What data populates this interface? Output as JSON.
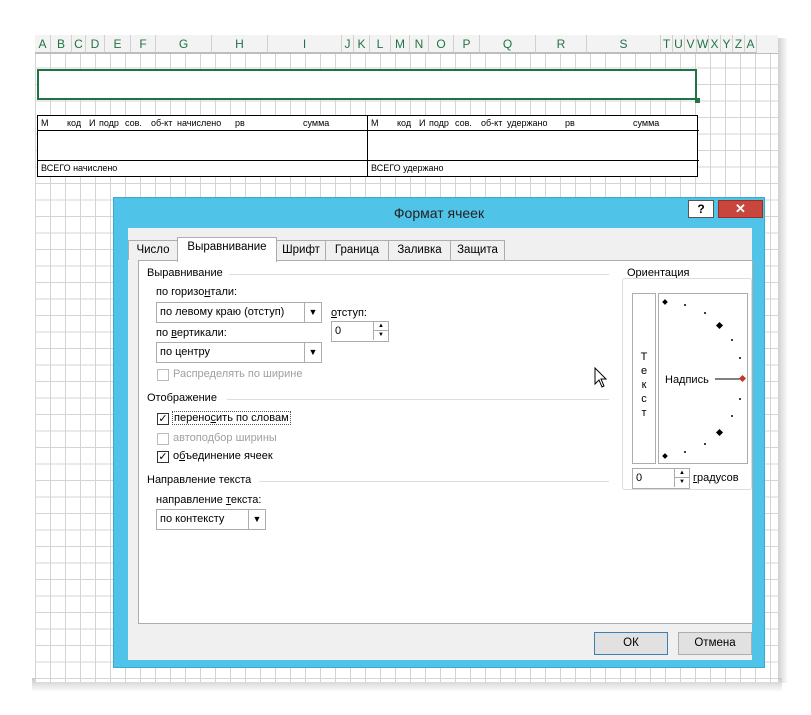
{
  "sheet": {
    "columns": [
      "A",
      "B",
      "C",
      "D",
      "E",
      "F",
      "G",
      "H",
      "I",
      "J",
      "K",
      "L",
      "M",
      "N",
      "O",
      "P",
      "Q",
      "R",
      "S",
      "T",
      "U",
      "V",
      "W",
      "X",
      "Y",
      "Z",
      "A"
    ],
    "left_table": {
      "headers": [
        "М",
        "код",
        "И",
        "подр",
        "сов.",
        "об-кт",
        "начислено",
        "рв",
        "сумма"
      ],
      "total_label": "ВСЕГО начислено"
    },
    "right_table": {
      "headers": [
        "М",
        "код",
        "И",
        "подр",
        "сов.",
        "об-кт",
        "удержано",
        "рв",
        "сумма"
      ],
      "total_label": "ВСЕГО удержано"
    }
  },
  "dialog": {
    "title": "Формат ячеек",
    "help_label": "?",
    "close_label": "✕",
    "tabs": [
      "Число",
      "Выравнивание",
      "Шрифт",
      "Граница",
      "Заливка",
      "Защита"
    ],
    "active_tab": "Выравнивание",
    "alignment": {
      "group_label": "Выравнивание",
      "horizontal_label": "по горизонтали:",
      "horizontal_value": "по левому краю (отступ)",
      "indent_label": "отступ:",
      "indent_value": "0",
      "vertical_label": "по вертикали:",
      "vertical_value": "по центру",
      "distribute_label": "Распределять по ширине"
    },
    "display": {
      "group_label": "Отображение",
      "wrap_label": "переносить по словам",
      "wrap_checked": true,
      "shrink_label": "автоподбор ширины",
      "shrink_checked": false,
      "merge_label": "объединение ячеек",
      "merge_checked": true
    },
    "text_direction": {
      "group_label": "Направление текста",
      "direction_label": "направление текста:",
      "direction_value": "по контексту"
    },
    "orientation": {
      "group_label": "Ориентация",
      "vertical_text": [
        "Т",
        "е",
        "к",
        "с",
        "т"
      ],
      "dial_label": "Надпись",
      "degrees_value": "0",
      "degrees_label": "градусов",
      "marker_color": "#c0392b"
    },
    "ok_label": "ОК",
    "cancel_label": "Отмена"
  },
  "colors": {
    "title_bar": "#4fc3e8",
    "close_button": "#c9463d",
    "excel_green": "#217346"
  }
}
